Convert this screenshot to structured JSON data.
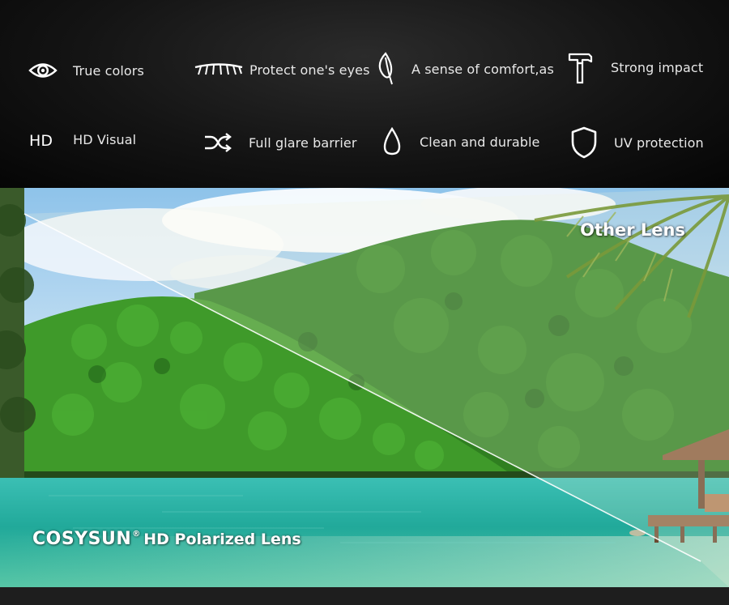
{
  "features": [
    {
      "icon": "eye-icon",
      "label": "True colors"
    },
    {
      "icon": "eyelash-icon",
      "label": "Protect one's eyes"
    },
    {
      "icon": "feather-icon",
      "label": "A sense of comfort,as"
    },
    {
      "icon": "hammer-icon",
      "label": "Strong impact"
    },
    {
      "icon": "hd-icon",
      "icon_text": "HD",
      "label": "HD Visual"
    },
    {
      "icon": "shuffle-icon",
      "label": "Full glare barrier"
    },
    {
      "icon": "droplet-icon",
      "label": "Clean and durable"
    },
    {
      "icon": "shield-icon",
      "label": "UV protection"
    }
  ],
  "comparison": {
    "other_label": "Other Lens",
    "brand_name": "COSYSUN",
    "brand_mark": "®",
    "brand_tagline": "HD Polarized Lens"
  },
  "colors": {
    "panel_background": "#111111",
    "text": "#e8e8e8",
    "divider_line": "#ffffff",
    "sea": "#2fb8a8",
    "foliage": "#2f8a24"
  }
}
